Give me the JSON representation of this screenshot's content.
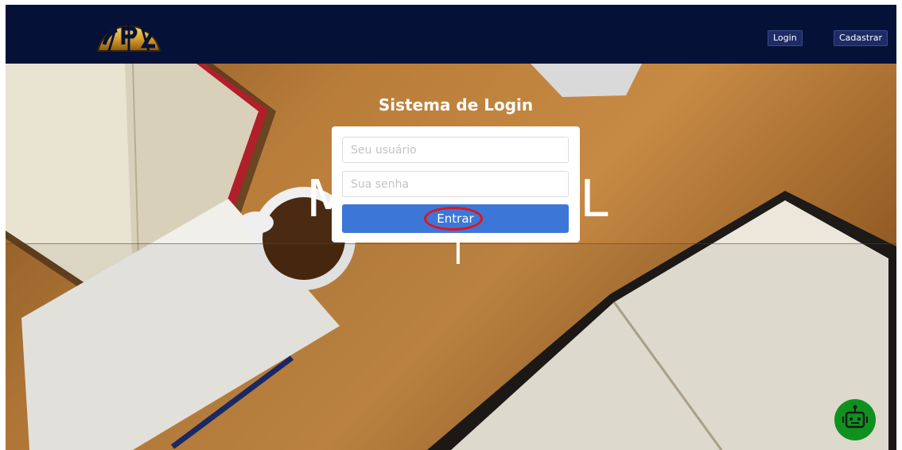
{
  "navbar": {
    "login_label": "Login",
    "signup_label": "Cadastrar",
    "logo_icon": "cpl-logo-icon"
  },
  "hero": {
    "title": "Sistema de Login",
    "background_letters": [
      "M",
      "L",
      "I"
    ]
  },
  "login_form": {
    "username_placeholder": "Seu usuário",
    "password_placeholder": "Sua senha",
    "submit_label": "Entrar"
  },
  "chatbot": {
    "icon": "robot-icon"
  },
  "colors": {
    "navbar_bg": "#061138",
    "submit_bg": "#3c77d8",
    "highlight": "#e0141c",
    "bot_bg": "#10911e"
  }
}
